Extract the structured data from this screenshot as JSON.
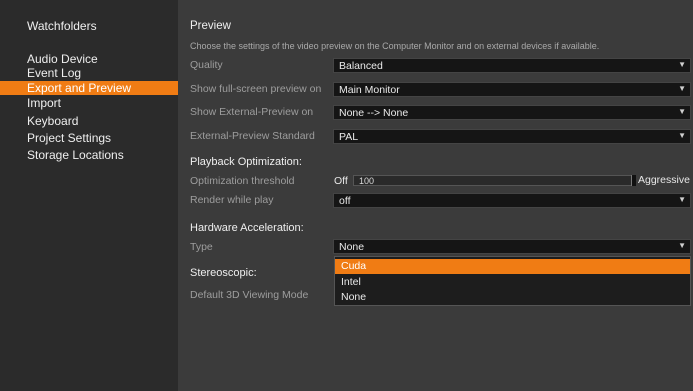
{
  "sidebar": {
    "items": [
      {
        "label": "Watchfolders"
      },
      {
        "label": "Audio Device"
      },
      {
        "label": "Event Log"
      },
      {
        "label": "Export and Preview"
      },
      {
        "label": "Import"
      },
      {
        "label": "Keyboard"
      },
      {
        "label": "Project Settings"
      },
      {
        "label": "Storage Locations"
      }
    ],
    "selected": "Export and Preview"
  },
  "preview": {
    "title": "Preview",
    "description": "Choose the settings of the video preview on the Computer Monitor and on external devices if available.",
    "quality": {
      "label": "Quality",
      "value": "Balanced"
    },
    "fullscreen": {
      "label": "Show full-screen preview on",
      "value": "Main Monitor"
    },
    "external": {
      "label": "Show External-Preview on",
      "value": "None --> None"
    },
    "standard": {
      "label": "External-Preview Standard",
      "value": "PAL"
    }
  },
  "playback": {
    "title": "Playback Optimization:",
    "threshold": {
      "label": "Optimization threshold",
      "min_label": "Off",
      "value": "100",
      "max_label": "Aggressive",
      "level": 1.0
    },
    "render": {
      "label": "Render while play",
      "value": "off"
    }
  },
  "hardware": {
    "title": "Hardware Acceleration:",
    "type": {
      "label": "Type",
      "value": "None"
    },
    "options": [
      "Cuda",
      "Intel",
      "None"
    ],
    "highlighted": "Cuda"
  },
  "stereo": {
    "title": "Stereoscopic:",
    "mode": {
      "label": "Default 3D Viewing Mode"
    }
  },
  "colors": {
    "accent": "#f07c14",
    "background": "#3b3b3b",
    "sidebar": "#2b2b2b"
  },
  "icons": {
    "dropdown": "triangle-down-icon"
  }
}
